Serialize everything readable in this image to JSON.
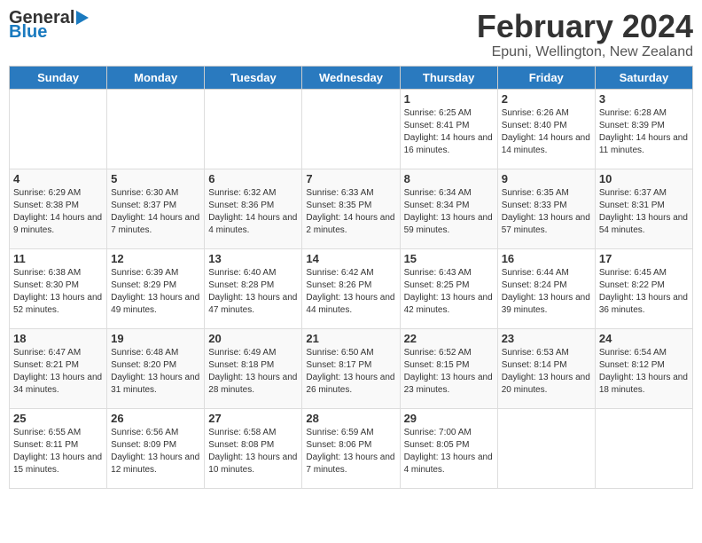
{
  "header": {
    "logo_general": "General",
    "logo_blue": "Blue",
    "main_title": "February 2024",
    "subtitle": "Epuni, Wellington, New Zealand"
  },
  "weekdays": [
    "Sunday",
    "Monday",
    "Tuesday",
    "Wednesday",
    "Thursday",
    "Friday",
    "Saturday"
  ],
  "weeks": [
    [
      {
        "day": "",
        "info": ""
      },
      {
        "day": "",
        "info": ""
      },
      {
        "day": "",
        "info": ""
      },
      {
        "day": "",
        "info": ""
      },
      {
        "day": "1",
        "info": "Sunrise: 6:25 AM\nSunset: 8:41 PM\nDaylight: 14 hours and 16 minutes."
      },
      {
        "day": "2",
        "info": "Sunrise: 6:26 AM\nSunset: 8:40 PM\nDaylight: 14 hours and 14 minutes."
      },
      {
        "day": "3",
        "info": "Sunrise: 6:28 AM\nSunset: 8:39 PM\nDaylight: 14 hours and 11 minutes."
      }
    ],
    [
      {
        "day": "4",
        "info": "Sunrise: 6:29 AM\nSunset: 8:38 PM\nDaylight: 14 hours and 9 minutes."
      },
      {
        "day": "5",
        "info": "Sunrise: 6:30 AM\nSunset: 8:37 PM\nDaylight: 14 hours and 7 minutes."
      },
      {
        "day": "6",
        "info": "Sunrise: 6:32 AM\nSunset: 8:36 PM\nDaylight: 14 hours and 4 minutes."
      },
      {
        "day": "7",
        "info": "Sunrise: 6:33 AM\nSunset: 8:35 PM\nDaylight: 14 hours and 2 minutes."
      },
      {
        "day": "8",
        "info": "Sunrise: 6:34 AM\nSunset: 8:34 PM\nDaylight: 13 hours and 59 minutes."
      },
      {
        "day": "9",
        "info": "Sunrise: 6:35 AM\nSunset: 8:33 PM\nDaylight: 13 hours and 57 minutes."
      },
      {
        "day": "10",
        "info": "Sunrise: 6:37 AM\nSunset: 8:31 PM\nDaylight: 13 hours and 54 minutes."
      }
    ],
    [
      {
        "day": "11",
        "info": "Sunrise: 6:38 AM\nSunset: 8:30 PM\nDaylight: 13 hours and 52 minutes."
      },
      {
        "day": "12",
        "info": "Sunrise: 6:39 AM\nSunset: 8:29 PM\nDaylight: 13 hours and 49 minutes."
      },
      {
        "day": "13",
        "info": "Sunrise: 6:40 AM\nSunset: 8:28 PM\nDaylight: 13 hours and 47 minutes."
      },
      {
        "day": "14",
        "info": "Sunrise: 6:42 AM\nSunset: 8:26 PM\nDaylight: 13 hours and 44 minutes."
      },
      {
        "day": "15",
        "info": "Sunrise: 6:43 AM\nSunset: 8:25 PM\nDaylight: 13 hours and 42 minutes."
      },
      {
        "day": "16",
        "info": "Sunrise: 6:44 AM\nSunset: 8:24 PM\nDaylight: 13 hours and 39 minutes."
      },
      {
        "day": "17",
        "info": "Sunrise: 6:45 AM\nSunset: 8:22 PM\nDaylight: 13 hours and 36 minutes."
      }
    ],
    [
      {
        "day": "18",
        "info": "Sunrise: 6:47 AM\nSunset: 8:21 PM\nDaylight: 13 hours and 34 minutes."
      },
      {
        "day": "19",
        "info": "Sunrise: 6:48 AM\nSunset: 8:20 PM\nDaylight: 13 hours and 31 minutes."
      },
      {
        "day": "20",
        "info": "Sunrise: 6:49 AM\nSunset: 8:18 PM\nDaylight: 13 hours and 28 minutes."
      },
      {
        "day": "21",
        "info": "Sunrise: 6:50 AM\nSunset: 8:17 PM\nDaylight: 13 hours and 26 minutes."
      },
      {
        "day": "22",
        "info": "Sunrise: 6:52 AM\nSunset: 8:15 PM\nDaylight: 13 hours and 23 minutes."
      },
      {
        "day": "23",
        "info": "Sunrise: 6:53 AM\nSunset: 8:14 PM\nDaylight: 13 hours and 20 minutes."
      },
      {
        "day": "24",
        "info": "Sunrise: 6:54 AM\nSunset: 8:12 PM\nDaylight: 13 hours and 18 minutes."
      }
    ],
    [
      {
        "day": "25",
        "info": "Sunrise: 6:55 AM\nSunset: 8:11 PM\nDaylight: 13 hours and 15 minutes."
      },
      {
        "day": "26",
        "info": "Sunrise: 6:56 AM\nSunset: 8:09 PM\nDaylight: 13 hours and 12 minutes."
      },
      {
        "day": "27",
        "info": "Sunrise: 6:58 AM\nSunset: 8:08 PM\nDaylight: 13 hours and 10 minutes."
      },
      {
        "day": "28",
        "info": "Sunrise: 6:59 AM\nSunset: 8:06 PM\nDaylight: 13 hours and 7 minutes."
      },
      {
        "day": "29",
        "info": "Sunrise: 7:00 AM\nSunset: 8:05 PM\nDaylight: 13 hours and 4 minutes."
      },
      {
        "day": "",
        "info": ""
      },
      {
        "day": "",
        "info": ""
      }
    ]
  ]
}
